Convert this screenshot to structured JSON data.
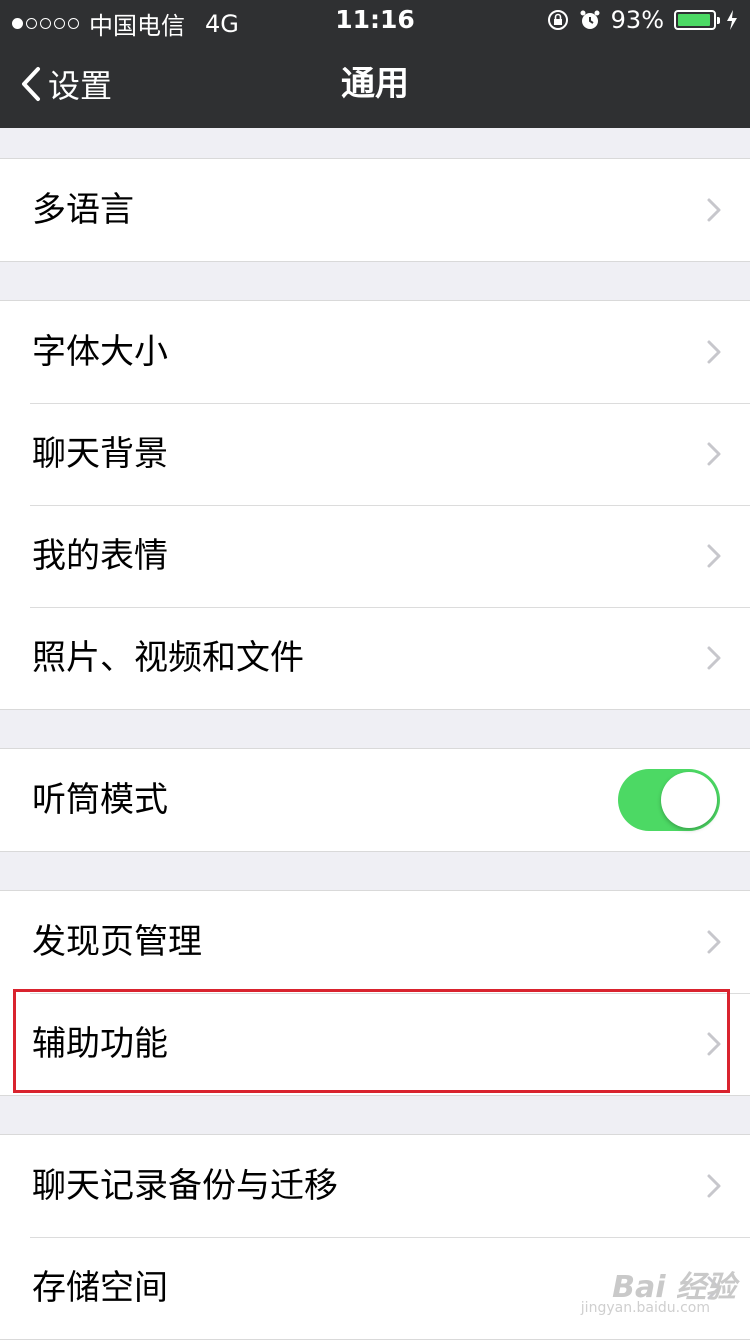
{
  "status_bar": {
    "carrier": "中国电信",
    "network": "4G",
    "time": "11:16",
    "battery_text": "93%",
    "battery_level": 0.93
  },
  "nav": {
    "back_label": "设置",
    "title": "通用"
  },
  "groups": [
    {
      "items": [
        {
          "label": "多语言",
          "type": "chevron"
        }
      ]
    },
    {
      "items": [
        {
          "label": "字体大小",
          "type": "chevron"
        },
        {
          "label": "聊天背景",
          "type": "chevron"
        },
        {
          "label": "我的表情",
          "type": "chevron"
        },
        {
          "label": "照片、视频和文件",
          "type": "chevron"
        }
      ]
    },
    {
      "items": [
        {
          "label": "听筒模式",
          "type": "toggle",
          "on": true
        }
      ]
    },
    {
      "items": [
        {
          "label": "发现页管理",
          "type": "chevron"
        },
        {
          "label": "辅助功能",
          "type": "chevron",
          "highlighted": true
        }
      ]
    },
    {
      "items": [
        {
          "label": "聊天记录备份与迁移",
          "type": "chevron"
        },
        {
          "label": "存储空间",
          "type": "chevron"
        }
      ]
    }
  ],
  "watermark": {
    "text": "Bai 经验",
    "sub": "jingyan.baidu.com"
  },
  "colors": {
    "nav_bg": "#2f3032",
    "toggle_on": "#4cd964",
    "highlight": "#d9232e",
    "page_bg": "#efeff4"
  }
}
